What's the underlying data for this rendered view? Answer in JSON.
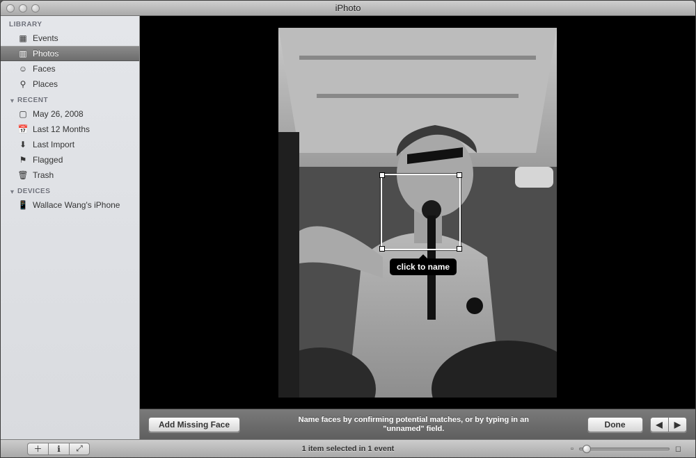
{
  "window_title": "iPhoto",
  "sidebar": {
    "sections": [
      {
        "label": "LIBRARY",
        "collapsible": false,
        "items": [
          {
            "label": "Events",
            "icon": "events",
            "selected": false
          },
          {
            "label": "Photos",
            "icon": "photos",
            "selected": true
          },
          {
            "label": "Faces",
            "icon": "faces",
            "selected": false
          },
          {
            "label": "Places",
            "icon": "places",
            "selected": false
          }
        ]
      },
      {
        "label": "RECENT",
        "collapsible": true,
        "items": [
          {
            "label": "May 26, 2008",
            "icon": "event-date"
          },
          {
            "label": "Last 12 Months",
            "icon": "calendar"
          },
          {
            "label": "Last Import",
            "icon": "import"
          },
          {
            "label": "Flagged",
            "icon": "flag"
          },
          {
            "label": "Trash",
            "icon": "trash"
          }
        ]
      },
      {
        "label": "DEVICES",
        "collapsible": true,
        "items": [
          {
            "label": "Wallace Wang's iPhone",
            "icon": "iphone"
          }
        ]
      }
    ]
  },
  "viewer": {
    "face_tag_prompt": "click to name"
  },
  "action_bar": {
    "add_face_label": "Add Missing Face",
    "help_line1": "Name faces by confirming potential matches, or by typing in an",
    "help_line2": "\"unnamed\" field.",
    "done_label": "Done"
  },
  "statusbar": {
    "text": "1 item selected in 1 event"
  }
}
